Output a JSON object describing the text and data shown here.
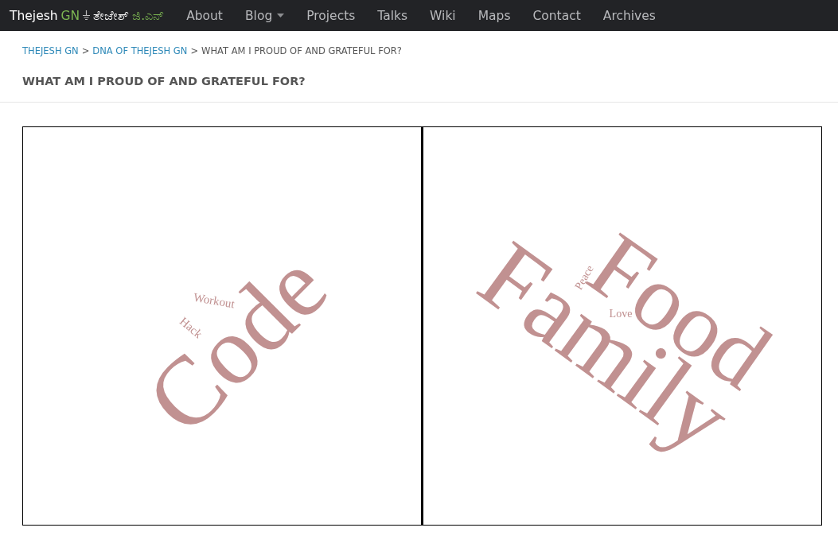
{
  "navbar": {
    "brand": {
      "name": "Thejesh",
      "initials": "GN",
      "kannada_name": "ತೇಜೇಶ್",
      "kannada_initials": "ಜಿ.ಎನ್"
    },
    "items": [
      {
        "label": "About",
        "dropdown": false
      },
      {
        "label": "Blog",
        "dropdown": true
      },
      {
        "label": "Projects",
        "dropdown": false
      },
      {
        "label": "Talks",
        "dropdown": false
      },
      {
        "label": "Wiki",
        "dropdown": false
      },
      {
        "label": "Maps",
        "dropdown": false
      },
      {
        "label": "Contact",
        "dropdown": false
      },
      {
        "label": "Archives",
        "dropdown": false
      }
    ]
  },
  "breadcrumb": {
    "links": [
      "THEJESH GN",
      "DNA OF THEJESH GN"
    ],
    "separator": ">",
    "current": "WHAT AM I PROUD OF AND GRATEFUL FOR?"
  },
  "page_title": "WHAT AM I PROUD OF AND GRATEFUL FOR?",
  "word_clouds": [
    {
      "words": [
        "Code",
        "Workout",
        "Hack"
      ]
    },
    {
      "words": [
        "Food",
        "Family",
        "Peace",
        "Love"
      ]
    }
  ]
}
